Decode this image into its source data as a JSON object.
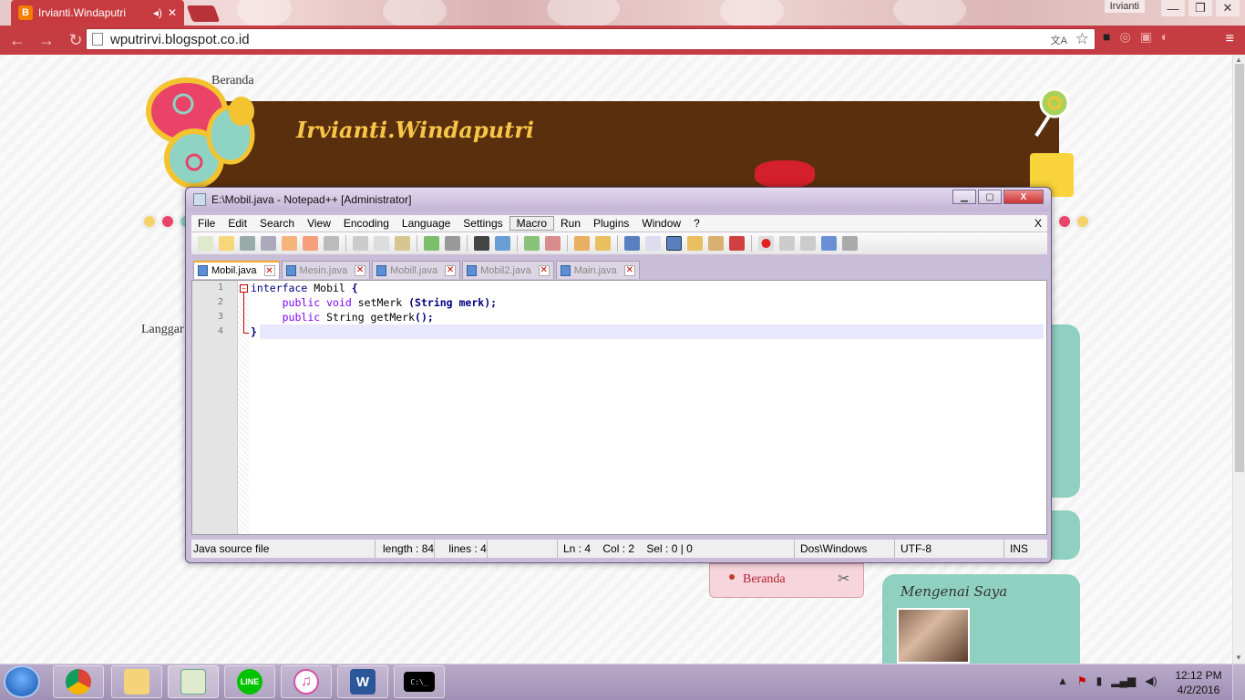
{
  "browser": {
    "tab_title": "Irvianti.Windaputri",
    "tab_close": "✕",
    "profile_name": "Irvianti",
    "url": "wputrirvi.blogspot.co.id",
    "accent_color": "#c63c43",
    "window_controls": [
      "—",
      "❐",
      "✕"
    ]
  },
  "blog": {
    "nav_link": "Beranda",
    "title": "Irvianti.Windaputri",
    "left_text": "Langgar",
    "pages_widget": {
      "item": "Beranda"
    },
    "about_title": "Mengenai Saya"
  },
  "npp": {
    "window_title": "E:\\Mobil.java - Notepad++ [Administrator]",
    "menu": [
      "File",
      "Edit",
      "Search",
      "View",
      "Encoding",
      "Language",
      "Settings",
      "Macro",
      "Run",
      "Plugins",
      "Window",
      "?"
    ],
    "menu_close": "X",
    "tabs": [
      "Mobil.java",
      "Mesin.java",
      "Mobill.java",
      "Mobil2.java",
      "Main.java"
    ],
    "line_numbers": [
      "1",
      "2",
      "3",
      "4"
    ],
    "code": {
      "l1_kw": "interface",
      "l1_rest": " Mobil ",
      "l1_brace": "{",
      "l2_indent": "     ",
      "l2_kw1": "public",
      "l2_kw2": "void",
      "l2_rest": " setMerk ",
      "l2_paren": "(String merk);",
      "l3_indent": "     ",
      "l3_kw1": "public",
      "l3_rest": " String getMerk",
      "l3_paren": "();",
      "l4_brace": "}"
    },
    "status": {
      "file_type": "Java source file",
      "length": "length : 84",
      "lines": "lines : 4",
      "position": "Ln : 4    Col : 2    Sel : 0 | 0",
      "eol": "Dos\\Windows",
      "encoding": "UTF-8",
      "mode": "INS"
    }
  },
  "taskbar": {
    "apps": [
      "chrome-icon",
      "explorer-icon",
      "notepadpp-icon",
      "line-icon",
      "itunes-icon",
      "word-icon",
      "cmd-icon"
    ],
    "line_label": "LINE",
    "word_label": "W",
    "cmd_label": "C:\\_",
    "time": "12:12 PM",
    "date": "4/2/2016"
  }
}
